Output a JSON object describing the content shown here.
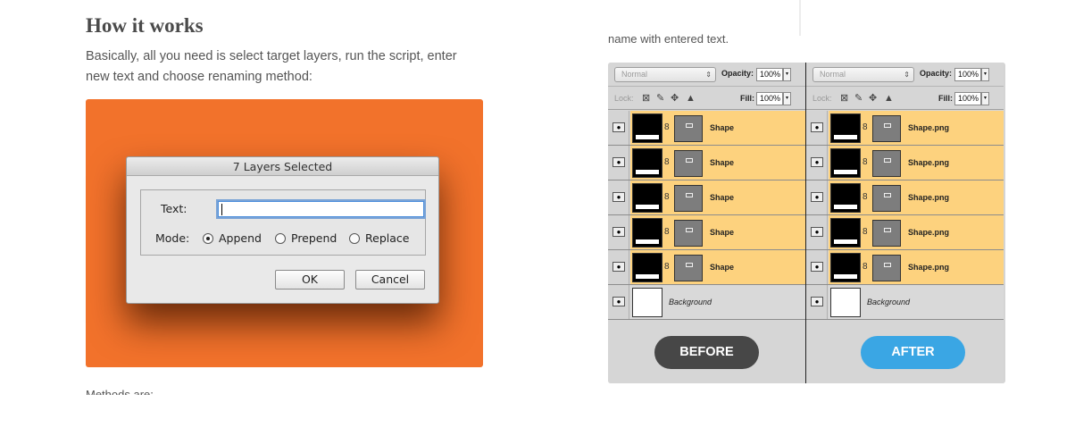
{
  "article": {
    "heading": "How it works",
    "intro": "Basically, all you need is select target layers, run the script, enter new text and choose renaming method:",
    "next_text": "Methods are:"
  },
  "dialog": {
    "title": "7 Layers Selected",
    "text_label": "Text:",
    "text_value": "",
    "mode_label": "Mode:",
    "modes": [
      {
        "label": "Append",
        "selected": true
      },
      {
        "label": "Prepend",
        "selected": false
      },
      {
        "label": "Replace",
        "selected": false
      }
    ],
    "ok_label": "OK",
    "cancel_label": "Cancel"
  },
  "comparison": {
    "caption_text": "name with entered text.",
    "panels": [
      {
        "blend_mode": "Normal",
        "opacity_label": "Opacity:",
        "opacity": "100%",
        "lock_label": "Lock:",
        "fill_label": "Fill:",
        "fill": "100%",
        "layers": [
          "Shape",
          "Shape",
          "Shape",
          "Shape",
          "Shape"
        ],
        "background_layer": "Background",
        "badge": "BEFORE"
      },
      {
        "blend_mode": "Normal",
        "opacity_label": "Opacity:",
        "opacity": "100%",
        "lock_label": "Lock:",
        "fill_label": "Fill:",
        "fill": "100%",
        "layers": [
          "Shape.png",
          "Shape.png",
          "Shape.png",
          "Shape.png",
          "Shape.png"
        ],
        "background_layer": "Background",
        "badge": "AFTER"
      }
    ]
  },
  "colors": {
    "orange": "#f2722b",
    "layer_highlight": "#fdd27e",
    "before_badge": "#474747",
    "after_badge": "#3aa6e4"
  },
  "icons": [
    "eye-icon",
    "chain-link-icon",
    "lock-transparent-icon",
    "brush-icon",
    "move-icon",
    "lock-icon",
    "radio-icon",
    "dropdown-arrow-icon"
  ]
}
